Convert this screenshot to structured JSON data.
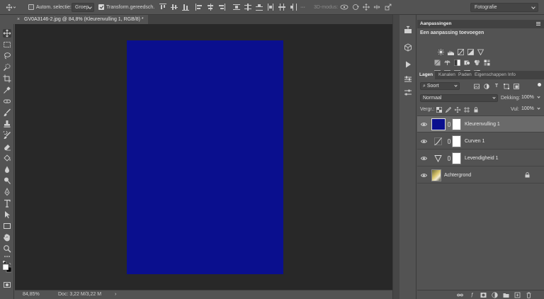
{
  "options_bar": {
    "auto_select_label": "Autom. selectie:",
    "auto_select_value": "Groep",
    "transform_label": "Transform.gereedsch.",
    "mode_3d_label": "3D-modus:",
    "workspace": "Fotografie"
  },
  "document_tab": {
    "close_glyph": "×",
    "title": "GV0A3146-2.jpg @ 84,8% (Kleurenvulling 1, RGB/8) *"
  },
  "status_bar": {
    "zoom": "84,85%",
    "doc_info": "Doc: 3,22 M/3,22 M",
    "arrow": "›"
  },
  "adjustments_panel": {
    "title": "Aanpassingen",
    "subtitle": "Een aanpassing toevoegen"
  },
  "layers_panel": {
    "tabs": [
      "Lagen",
      "Kanalen",
      "Paden",
      "Eigenschappen",
      "Info"
    ],
    "filter_kind": "Soort",
    "blend_mode": "Normaal",
    "opacity_label": "Dekking:",
    "opacity_value": "100%",
    "lock_label": "Vergr.:",
    "fill_label": "Vul:",
    "fill_value": "100%",
    "layers": [
      {
        "name": "Kleurenvulling 1"
      },
      {
        "name": "Curven 1"
      },
      {
        "name": "Levendigheid 1"
      },
      {
        "name": "Achtergrond"
      }
    ]
  },
  "colors": {
    "fill_color": "#0a0f8e",
    "panel_bg": "#535353",
    "canvas_bg": "#282828"
  }
}
